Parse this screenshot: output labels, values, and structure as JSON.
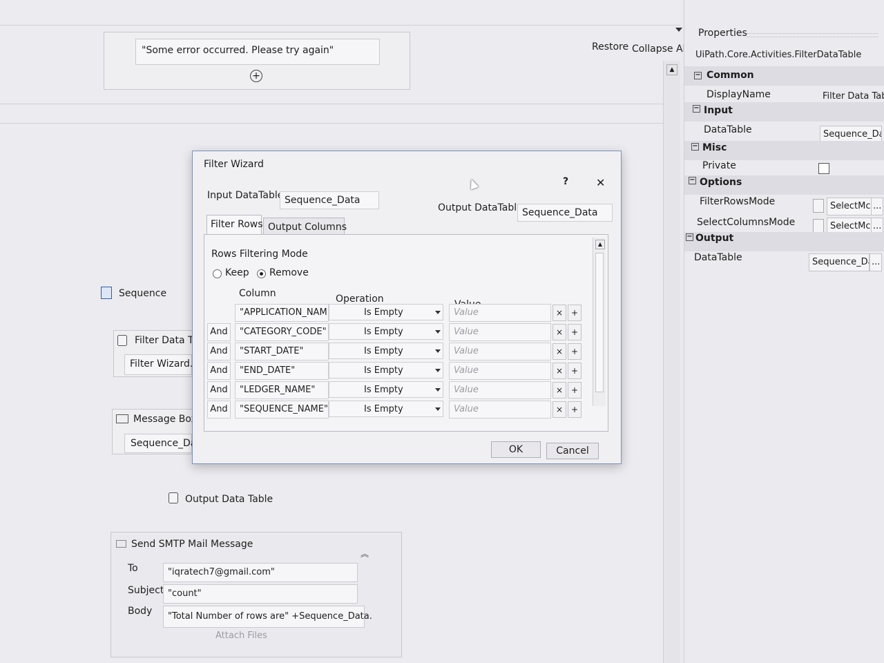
{
  "designer": {
    "error_message": "\"Some error occurred. Please try again\"",
    "restore_label": "Restore",
    "collapse_all_label": "Collapse All",
    "sequence_label": "Sequence",
    "filter_data_table_label": "Filter Data Tal",
    "filter_wizard_button": "Filter Wizard...",
    "message_box_label": "Message Box",
    "message_box_value": "Sequence_Dat",
    "output_data_table_label": "Output Data Table",
    "smtp": {
      "title": "Send SMTP Mail Message",
      "to_label": "To",
      "to_value": "\"iqratech7@gmail.com\"",
      "subject_label": "Subject",
      "subject_value": "\"count\"",
      "body_label": "Body",
      "body_value": "\"Total Number of rows are\" +Sequence_Data.",
      "attach_files": "Attach Files"
    }
  },
  "properties": {
    "header": "Properties",
    "activity": "UiPath.Core.Activities.FilterDataTable",
    "categories": {
      "common": "Common",
      "input": "Input",
      "misc": "Misc",
      "options": "Options",
      "output": "Output"
    },
    "rows": {
      "display_name_label": "DisplayName",
      "display_name_value": "Filter Data Tab",
      "input_datatable_label": "DataTable",
      "input_datatable_value": "Sequence_Da",
      "private_label": "Private",
      "filter_rows_mode_label": "FilterRowsMode",
      "filter_rows_mode_value": "SelectMc",
      "select_columns_mode_label": "SelectColumnsMode",
      "select_columns_mode_value": "SelectMc",
      "output_datatable_label": "DataTable",
      "output_datatable_value": "Sequence_Da"
    },
    "ellipsis": "..."
  },
  "dialog": {
    "title": "Filter Wizard",
    "help": "?",
    "close": "✕",
    "input_label": "Input DataTable",
    "input_value": "Sequence_Data",
    "output_label": "Output DataTable",
    "output_value": "Sequence_Data",
    "tabs": [
      "Filter Rows",
      "Output Columns"
    ],
    "mode_label": "Rows Filtering Mode",
    "keep_label": "Keep",
    "remove_label": "Remove",
    "headers": {
      "column": "Column",
      "operation": "Operation",
      "value": "Value"
    },
    "rows": [
      {
        "connector": "",
        "column": "\"APPLICATION_NAM",
        "operation": "Is Empty",
        "value": "Value"
      },
      {
        "connector": "And",
        "column": "\"CATEGORY_CODE\"",
        "operation": "Is Empty",
        "value": "Value"
      },
      {
        "connector": "And",
        "column": "\"START_DATE\"",
        "operation": "Is Empty",
        "value": "Value"
      },
      {
        "connector": "And",
        "column": "\"END_DATE\"",
        "operation": "Is Empty",
        "value": "Value"
      },
      {
        "connector": "And",
        "column": "\"LEDGER_NAME\"",
        "operation": "Is Empty",
        "value": "Value"
      },
      {
        "connector": "And",
        "column": "\"SEQUENCE_NAME\"",
        "operation": "Is Empty",
        "value": "Value"
      }
    ],
    "remove_glyph": "×",
    "add_glyph": "+",
    "ok": "OK",
    "cancel": "Cancel"
  }
}
